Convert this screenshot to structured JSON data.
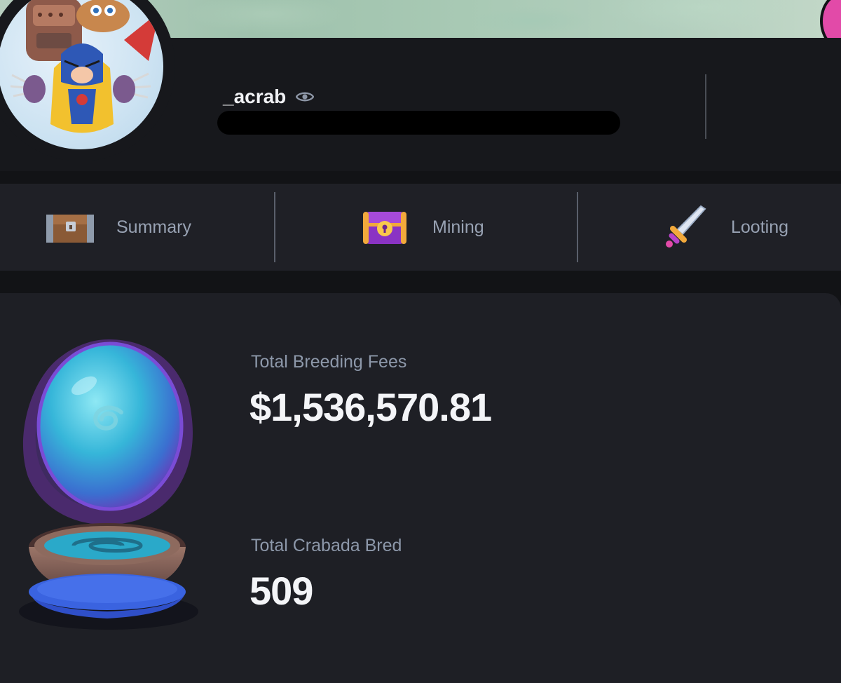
{
  "profile": {
    "username": "_acrab",
    "avatar_icon": "crab-character-avatar",
    "visibility_icon": "eye-icon"
  },
  "tabs": [
    {
      "label": "Summary",
      "icon": "treasure-chest-wooden-icon"
    },
    {
      "label": "Mining",
      "icon": "treasure-chest-purple-icon"
    },
    {
      "label": "Looting",
      "icon": "sword-icon"
    }
  ],
  "stats": {
    "breeding_fees_label": "Total Breeding Fees",
    "breeding_fees_value": "$1,536,570.81",
    "crabada_bred_label": "Total Crabada Bred",
    "crabada_bred_value": "509",
    "illustration_icon": "breeding-orb-icon"
  },
  "colors": {
    "background": "#121316",
    "panel": "#17181c",
    "tab_bar": "#1f2026",
    "card": "#1e1f25",
    "label_text": "#8d98aa",
    "value_text": "#f4f5f8",
    "accent_pink": "#e24aa8"
  }
}
